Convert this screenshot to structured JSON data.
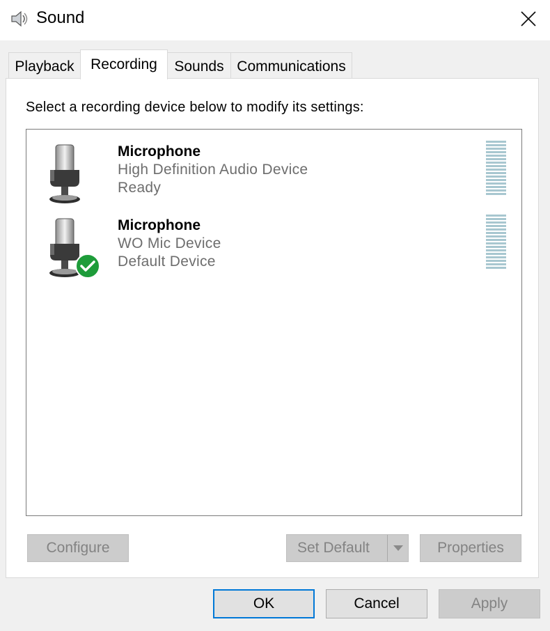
{
  "window": {
    "title": "Sound",
    "icon": "speaker-icon",
    "close_icon": "close-icon"
  },
  "tabs": [
    {
      "label": "Playback",
      "active": false
    },
    {
      "label": "Recording",
      "active": true
    },
    {
      "label": "Sounds",
      "active": false
    },
    {
      "label": "Communications",
      "active": false
    }
  ],
  "panel": {
    "instruction": "Select a recording device below to modify its settings:",
    "devices": [
      {
        "name": "Microphone",
        "description": "High Definition Audio Device",
        "status": "Ready",
        "icon": "microphone-icon",
        "is_default": false
      },
      {
        "name": "Microphone",
        "description": "WO Mic Device",
        "status": "Default Device",
        "icon": "microphone-icon",
        "badge_icon": "green-check-icon",
        "is_default": true
      }
    ],
    "buttons": {
      "configure": "Configure",
      "set_default": "Set Default",
      "properties": "Properties"
    }
  },
  "footer": {
    "ok": "OK",
    "cancel": "Cancel",
    "apply": "Apply"
  },
  "colors": {
    "accent": "#0078d7",
    "meter": "#a8c7d0",
    "check_green": "#1e9c3a",
    "disabled_text": "#838383"
  }
}
